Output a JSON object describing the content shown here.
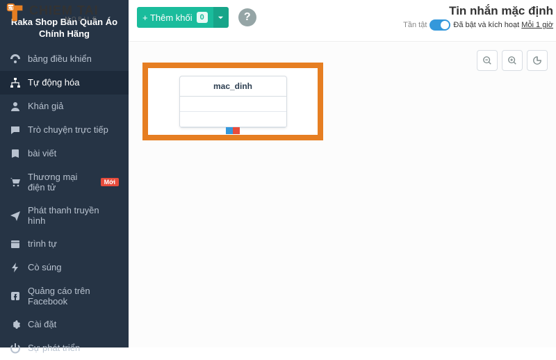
{
  "watermark": {
    "brand": "CHIEM TAI",
    "sub": "MOBILE"
  },
  "sidebar": {
    "shop_name": "Raka Shop Bán Quần Áo Chính Hãng",
    "items": [
      {
        "icon": "dashboard",
        "label": "bảng điều khiển"
      },
      {
        "icon": "sitemap",
        "label": "Tự động hóa"
      },
      {
        "icon": "user",
        "label": "Khán giả"
      },
      {
        "icon": "chat",
        "label": "Trò chuyện trực tiếp"
      },
      {
        "icon": "book",
        "label": "bài viết"
      },
      {
        "icon": "cart",
        "label": "Thương mại điện tử",
        "badge": "Mới"
      },
      {
        "icon": "send",
        "label": "Phát thanh truyền hình"
      },
      {
        "icon": "calendar",
        "label": "trình tự"
      },
      {
        "icon": "bolt",
        "label": "Cò súng"
      },
      {
        "icon": "facebook",
        "label": "Quảng cáo trên Facebook"
      },
      {
        "icon": "gear",
        "label": "Cài đặt"
      },
      {
        "icon": "power",
        "label": "Sự phát triển"
      }
    ]
  },
  "toolbar": {
    "add_block_label": "+ Thêm khối",
    "add_block_count": "0",
    "help_label": "?"
  },
  "header": {
    "title": "Tin nhắn mặc định",
    "status_off": "Tần tật",
    "status_on": "Đã bật",
    "status_rest": " và kích hoạt ",
    "status_link": "Mỗi 1 giờ"
  },
  "canvas": {
    "block": {
      "title": "mac_dinh"
    }
  }
}
